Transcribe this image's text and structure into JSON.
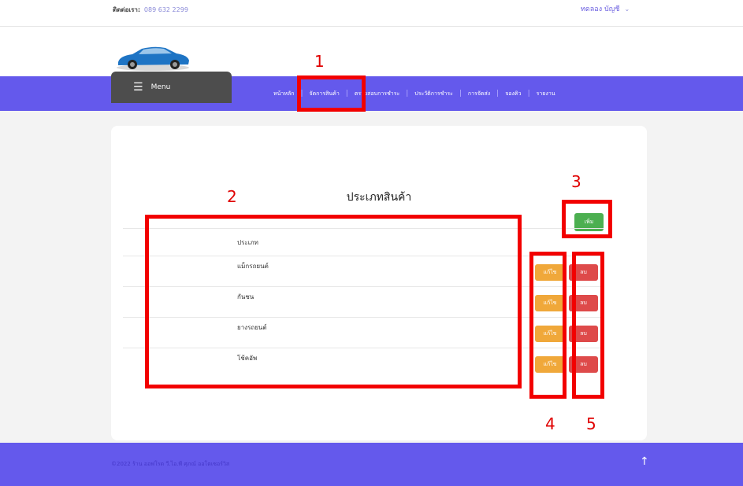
{
  "topbar": {
    "contact_label": "ติดต่อเรา:",
    "contact_phone": "089 632 2299",
    "account_label": "ทดลอง บัญชี"
  },
  "nav": {
    "menu_label": "Menu",
    "items": [
      {
        "label": "หน้าหลัก"
      },
      {
        "label": "จัดการสินค้า"
      },
      {
        "label": "ตรวจสอบการชำระ"
      },
      {
        "label": "ประวัติการชำระ"
      },
      {
        "label": "การจัดส่ง"
      },
      {
        "label": "จองคิว"
      },
      {
        "label": "รายงาน"
      }
    ]
  },
  "main": {
    "title": "ประเภทสินค้า",
    "add_label": "เพิ่ม",
    "table": {
      "header": "ประเภท",
      "edit_label": "แก้ไข",
      "delete_label": "ลบ",
      "rows": [
        {
          "name": "แม็กรถยนต์"
        },
        {
          "name": "กันชน"
        },
        {
          "name": "ยางรถยนต์"
        },
        {
          "name": "โช้คอัพ"
        }
      ]
    }
  },
  "footer": {
    "copyright": "©2022 ร้าน ออฟโรด วี.ไอ.พี ศุภณ์ ออโตเซอร์วิส"
  },
  "annotations": [
    "1",
    "2",
    "3",
    "4",
    "5"
  ],
  "colors": {
    "nav": "#6459ec",
    "add": "#4caf50",
    "edit": "#f0a83a",
    "delete": "#de4a4a",
    "highlight": "#f20000"
  }
}
